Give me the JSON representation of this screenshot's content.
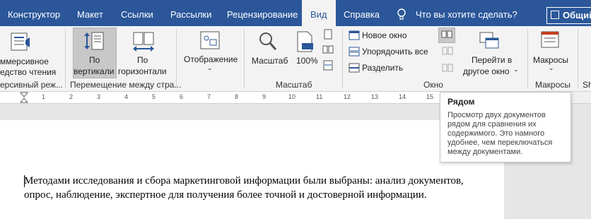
{
  "tabs": [
    "Конструктор",
    "Макет",
    "Ссылки",
    "Рассылки",
    "Рецензирование",
    "Вид",
    "Справка"
  ],
  "active_tab": "Вид",
  "tell_me": "Что вы хотите сделать?",
  "share": "Общий",
  "ribbon": {
    "immersive": {
      "line1": "ммерсивное",
      "line2": "едство чтения",
      "group": "ерсивный реж..."
    },
    "movement": {
      "vertical_1": "По",
      "vertical_2": "вертикали",
      "horizontal_1": "По",
      "horizontal_2": "горизонтали",
      "group": "Перемещение между стра..."
    },
    "display": {
      "label": "Отображение"
    },
    "zoom": {
      "zoom_label": "Масштаб",
      "percent_label": "100%",
      "group": "Масштаб"
    },
    "window": {
      "new_window": "Новое окно",
      "arrange_all": "Упорядочить все",
      "split": "Разделить",
      "switch_1": "Перейти в",
      "switch_2": "другое окно",
      "group": "Окно"
    },
    "macros": {
      "label": "Макросы",
      "group": "Макросы"
    },
    "extra": {
      "label": "Sh"
    }
  },
  "tooltip": {
    "title": "Рядом",
    "description": "Просмотр двух документов рядом для сравнения их содержимого. Это намного удобнее, чем переключаться между документами."
  },
  "document": {
    "text": "Методами исследования и сбора маркетинговой информации были выбраны: анализ документов, опрос, наблюдение, экспертное для получения более точной и достоверной информации."
  },
  "ruler": {
    "numbers": [
      "1",
      "2",
      "3",
      "4",
      "5",
      "6",
      "7",
      "8",
      "9",
      "10",
      "11",
      "12",
      "13",
      "14",
      "15"
    ]
  },
  "colors": {
    "tabbar": "#2b579a",
    "ribbon": "#f3f3f3"
  }
}
